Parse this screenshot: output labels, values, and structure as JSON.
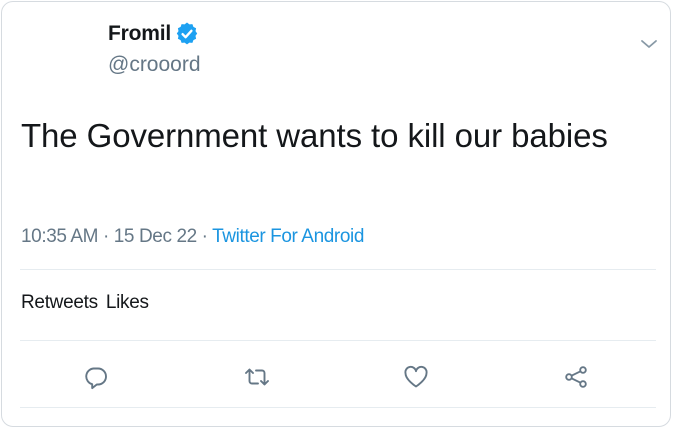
{
  "tweet": {
    "author": {
      "display_name": "Fromil",
      "handle": "@crooord",
      "verified_icon": "verified-badge-icon"
    },
    "text": "The Government wants to kill our babies",
    "timestamp": "10:35 AM · 15 Dec 22 ·",
    "source": "Twitter For Android",
    "stats": {
      "retweets_label": "Retweets",
      "likes_label": "Likes"
    }
  },
  "actions": [
    {
      "name": "reply",
      "icon": "reply-icon"
    },
    {
      "name": "retweet",
      "icon": "retweet-icon"
    },
    {
      "name": "like",
      "icon": "heart-icon"
    },
    {
      "name": "share",
      "icon": "share-icon"
    }
  ],
  "colors": {
    "text": "#14171a",
    "muted": "#657786",
    "accent": "#1b95e0",
    "border": "#d6dbe0"
  }
}
